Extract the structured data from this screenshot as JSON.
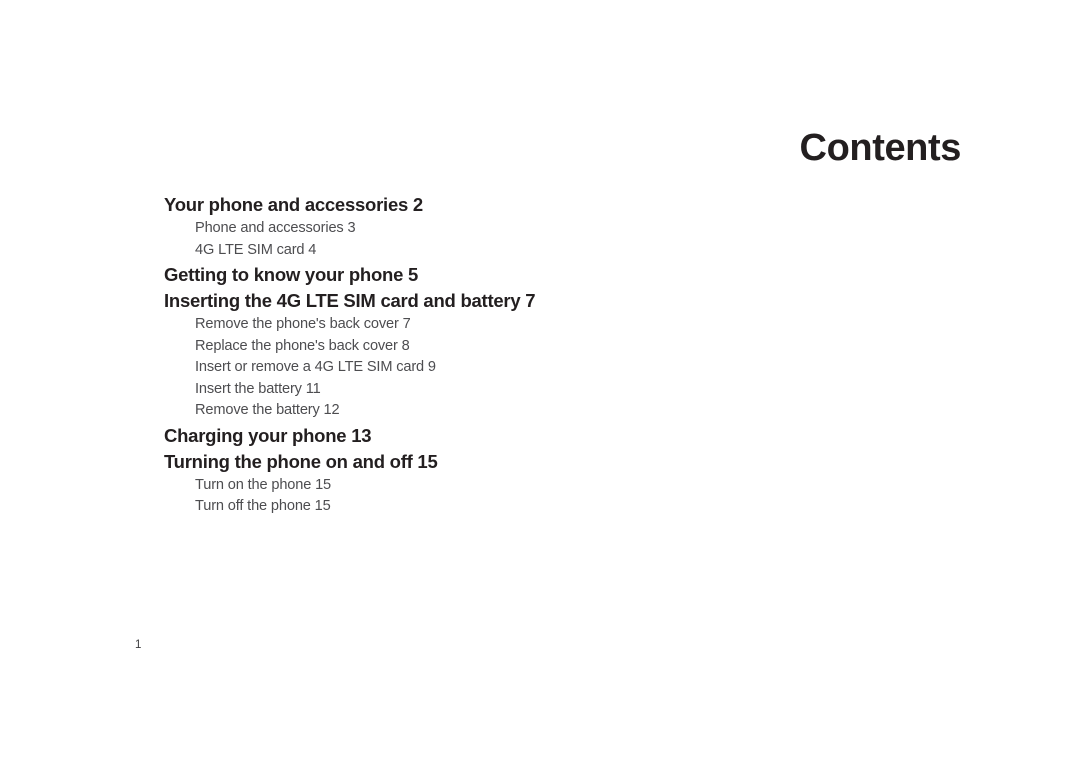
{
  "document": {
    "title": "Contents",
    "folio": "1"
  },
  "toc": {
    "entries": [
      {
        "level": 1,
        "text": "Your phone and accessories 2"
      },
      {
        "level": 2,
        "text": "Phone and accessories 3"
      },
      {
        "level": 2,
        "text": "4G LTE SIM card 4"
      },
      {
        "level": 1,
        "text": "Getting to know your phone 5"
      },
      {
        "level": 1,
        "text": "Inserting the 4G LTE SIM card and battery 7"
      },
      {
        "level": 2,
        "text": "Remove the phone's back cover 7"
      },
      {
        "level": 2,
        "text": "Replace the phone's back cover 8"
      },
      {
        "level": 2,
        "text": "Insert or remove a 4G LTE SIM card 9"
      },
      {
        "level": 2,
        "text": "Insert the battery 11"
      },
      {
        "level": 2,
        "text": "Remove the battery 12"
      },
      {
        "level": 1,
        "text": "Charging your phone 13"
      },
      {
        "level": 1,
        "text": "Turning the phone on and off 15"
      },
      {
        "level": 2,
        "text": "Turn on the phone 15"
      },
      {
        "level": 2,
        "text": "Turn off the phone 15"
      }
    ]
  },
  "colors": {
    "page_background": "#ffffff",
    "heading_text": "#231f20",
    "subentry_text": "#4d4d50",
    "folio_text": "#3c3c3e"
  }
}
